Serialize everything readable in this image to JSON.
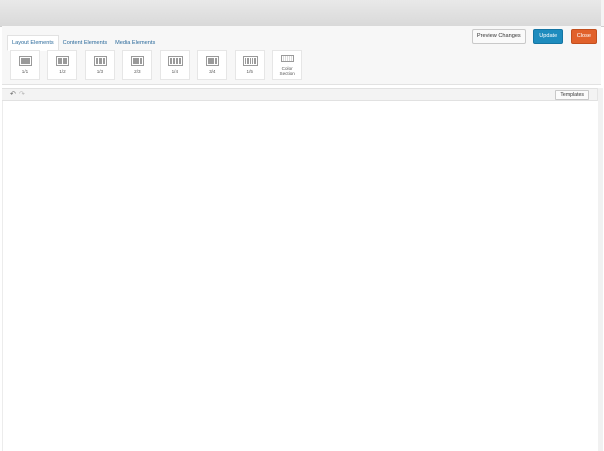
{
  "tabs": [
    {
      "label": "Layout Elements",
      "active": true
    },
    {
      "label": "Content Elements",
      "active": false
    },
    {
      "label": "Media Elements",
      "active": false
    }
  ],
  "actions": {
    "preview": "Preview Changes",
    "update": "Update",
    "close": "Close"
  },
  "elements": [
    {
      "label": "1/1",
      "icon": "column-1-1-icon"
    },
    {
      "label": "1/2",
      "icon": "column-1-2-icon"
    },
    {
      "label": "1/3",
      "icon": "column-1-3-icon"
    },
    {
      "label": "2/3",
      "icon": "column-2-3-icon"
    },
    {
      "label": "1/4",
      "icon": "column-1-4-icon"
    },
    {
      "label": "3/4",
      "icon": "column-3-4-icon"
    },
    {
      "label": "1/5",
      "icon": "column-1-5-icon"
    },
    {
      "label": "Color\nSection",
      "icon": "color-section-icon"
    }
  ],
  "toolbar": {
    "undo_icon": "undo-icon",
    "redo_icon": "redo-icon",
    "templates": "Templates"
  },
  "colors": {
    "update": "#1e8cbe",
    "close": "#e1612b",
    "tab_link": "#2b6a9b"
  }
}
